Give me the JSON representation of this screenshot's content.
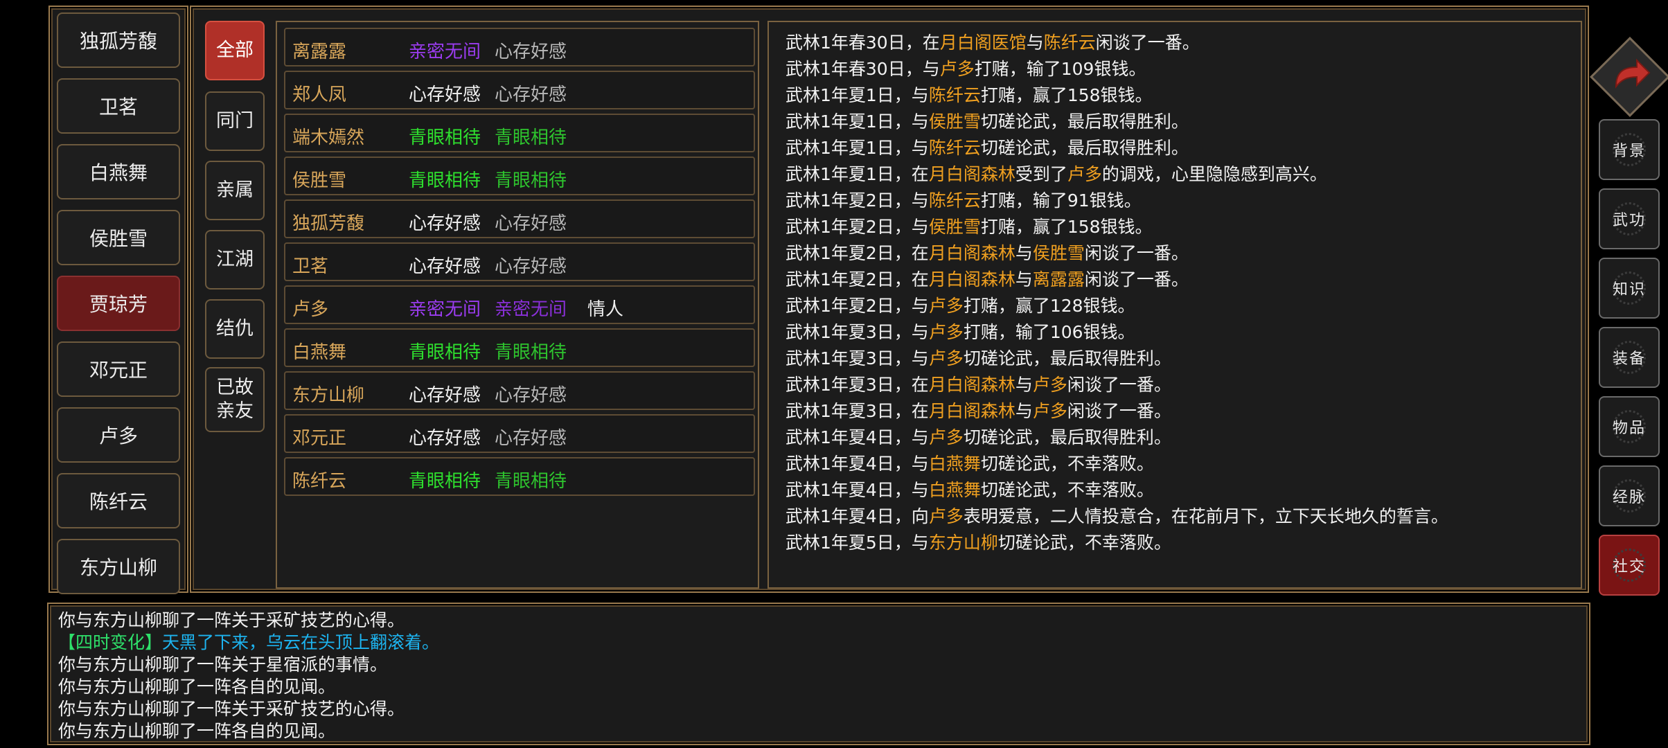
{
  "characters": [
    "独孤芳馥",
    "卫茗",
    "白燕舞",
    "侯胜雪",
    "贾琼芳",
    "邓元正",
    "卢多",
    "陈纤云",
    "东方山柳"
  ],
  "active_character": "贾琼芳",
  "categories": [
    "全部",
    "同门",
    "亲属",
    "江湖",
    "结仇",
    "已故亲友"
  ],
  "relations": [
    {
      "name": "离露露",
      "a": "亲密无间",
      "b": "心存好感",
      "c": "",
      "a_color": "#9b3cf0",
      "b_color": "#b8b8b8"
    },
    {
      "name": "郑人凤",
      "a": "心存好感",
      "b": "心存好感",
      "c": "",
      "a_color": "#f0f0f0",
      "b_color": "#b8b8b8"
    },
    {
      "name": "端木嫣然",
      "a": "青眼相待",
      "b": "青眼相待",
      "c": "",
      "a_color": "#2ee02e",
      "b_color": "#2ec42e"
    },
    {
      "name": "侯胜雪",
      "a": "青眼相待",
      "b": "青眼相待",
      "c": "",
      "a_color": "#2ee02e",
      "b_color": "#2ec42e"
    },
    {
      "name": "独孤芳馥",
      "a": "心存好感",
      "b": "心存好感",
      "c": "",
      "a_color": "#f0f0f0",
      "b_color": "#b8b8b8"
    },
    {
      "name": "卫茗",
      "a": "心存好感",
      "b": "心存好感",
      "c": "",
      "a_color": "#f0f0f0",
      "b_color": "#b8b8b8"
    },
    {
      "name": "卢多",
      "a": "亲密无间",
      "b": "亲密无间",
      "c": "情人",
      "a_color": "#9b3cf0",
      "b_color": "#8a30d8"
    },
    {
      "name": "白燕舞",
      "a": "青眼相待",
      "b": "青眼相待",
      "c": "",
      "a_color": "#2ee02e",
      "b_color": "#2ec42e"
    },
    {
      "name": "东方山柳",
      "a": "心存好感",
      "b": "心存好感",
      "c": "",
      "a_color": "#f0f0f0",
      "b_color": "#b8b8b8"
    },
    {
      "name": "邓元正",
      "a": "心存好感",
      "b": "心存好感",
      "c": "",
      "a_color": "#f0f0f0",
      "b_color": "#b8b8b8"
    },
    {
      "name": "陈纤云",
      "a": "青眼相待",
      "b": "青眼相待",
      "c": "",
      "a_color": "#2ee02e",
      "b_color": "#2ec42e"
    }
  ],
  "event_log": [
    [
      "武林1年春30日，在",
      "*月白阁医馆",
      "与",
      "*陈纤云",
      "闲谈了一番。"
    ],
    [
      "武林1年春30日，与",
      "*卢多",
      "打赌，输了109银钱。"
    ],
    [
      "武林1年夏1日，与",
      "*陈纤云",
      "打赌，赢了158银钱。"
    ],
    [
      "武林1年夏1日，与",
      "*侯胜雪",
      "切磋论武，最后取得胜利。"
    ],
    [
      "武林1年夏1日，与",
      "*陈纤云",
      "切磋论武，最后取得胜利。"
    ],
    [
      "武林1年夏1日，在",
      "*月白阁森林",
      "受到了",
      "*卢多",
      "的调戏，心里隐隐感到高兴。"
    ],
    [
      "武林1年夏2日，与",
      "*陈纤云",
      "打赌，输了91银钱。"
    ],
    [
      "武林1年夏2日，与",
      "*侯胜雪",
      "打赌，赢了158银钱。"
    ],
    [
      "武林1年夏2日，在",
      "*月白阁森林",
      "与",
      "*侯胜雪",
      "闲谈了一番。"
    ],
    [
      "武林1年夏2日，在",
      "*月白阁森林",
      "与",
      "*离露露",
      "闲谈了一番。"
    ],
    [
      "武林1年夏2日，与",
      "*卢多",
      "打赌，赢了128银钱。"
    ],
    [
      "武林1年夏3日，与",
      "*卢多",
      "打赌，输了106银钱。"
    ],
    [
      "武林1年夏3日，与",
      "*卢多",
      "切磋论武，最后取得胜利。"
    ],
    [
      "武林1年夏3日，在",
      "*月白阁森林",
      "与",
      "*卢多",
      "闲谈了一番。"
    ],
    [
      "武林1年夏3日，在",
      "*月白阁森林",
      "与",
      "*卢多",
      "闲谈了一番。"
    ],
    [
      "武林1年夏4日，与",
      "*卢多",
      "切磋论武，最后取得胜利。"
    ],
    [
      "武林1年夏4日，与",
      "*白燕舞",
      "切磋论武，不幸落败。"
    ],
    [
      "武林1年夏4日，与",
      "*白燕舞",
      "切磋论武，不幸落败。"
    ],
    [
      "武林1年夏4日，向",
      "*卢多",
      "表明爱意，二人情投意合，在花前月下，立下天长地久的誓言。"
    ],
    [
      "武林1年夏5日，与",
      "*东方山柳",
      "切磋论武，不幸落败。"
    ]
  ],
  "chat_log": [
    {
      "tag": "",
      "text": "你与东方山柳聊了一阵关于采矿技艺的心得。"
    },
    {
      "tag": "【四时变化】",
      "text": "天黑了下来，乌云在头顶上翻滚着。"
    },
    {
      "tag": "",
      "text": "你与东方山柳聊了一阵关于星宿派的事情。"
    },
    {
      "tag": "",
      "text": "你与东方山柳聊了一阵各自的见闻。"
    },
    {
      "tag": "",
      "text": "你与东方山柳聊了一阵关于采矿技艺的心得。"
    },
    {
      "tag": "",
      "text": "你与东方山柳聊了一阵各自的见闻。"
    }
  ],
  "side_menu": [
    "背景",
    "武功",
    "知识",
    "装备",
    "物品",
    "经脉",
    "社交"
  ],
  "active_side": "社交",
  "colors": {
    "highlight": "#f0a020",
    "name": "#d8a65a",
    "time_tag": "#2ee06a",
    "time_text": "#1db4f0",
    "active_red": "#6a1a1a"
  }
}
